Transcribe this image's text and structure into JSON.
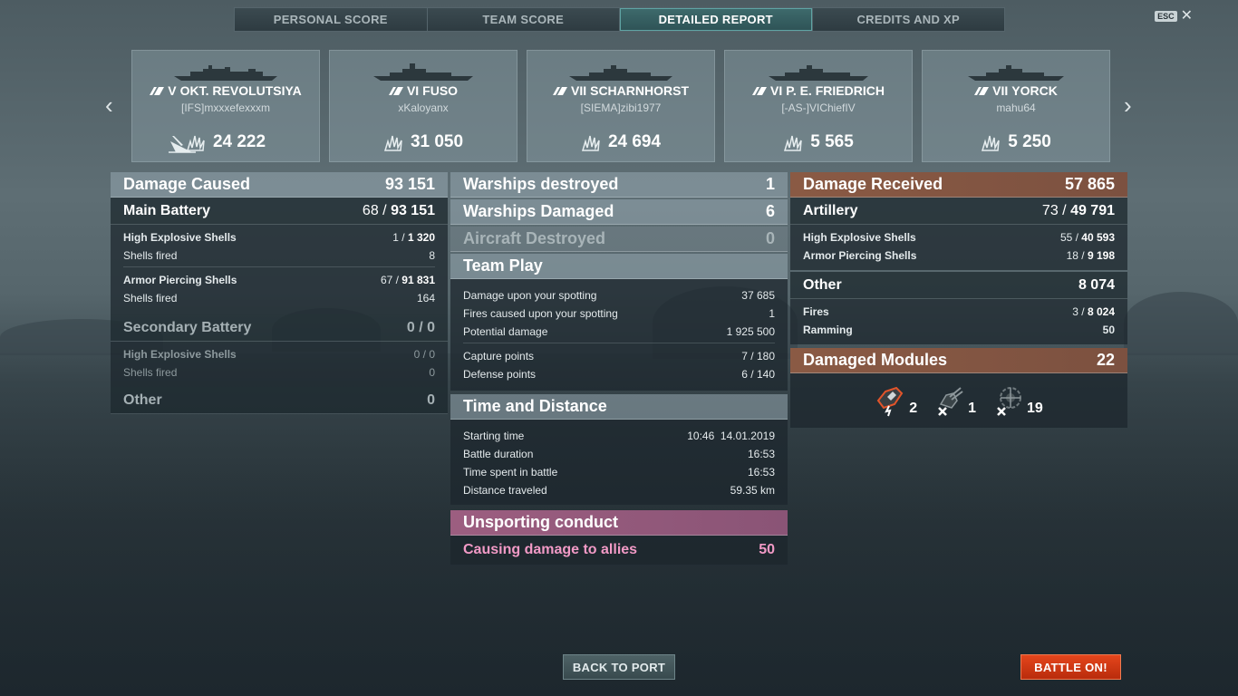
{
  "tabs": [
    {
      "label": "PERSONAL SCORE"
    },
    {
      "label": "TEAM SCORE"
    },
    {
      "label": "DETAILED REPORT",
      "active": true
    },
    {
      "label": "CREDITS AND XP"
    }
  ],
  "esc": {
    "key": "ESC",
    "close": "✕"
  },
  "cards": [
    {
      "tier": "V",
      "ship": "OKT. REVOLUTSIYA",
      "player": "[IFS]mxxxefexxxm",
      "damage": "24 222",
      "sunk": true
    },
    {
      "tier": "VI",
      "ship": "FUSO",
      "player": "xKaloyanx",
      "damage": "31 050"
    },
    {
      "tier": "VII",
      "ship": "SCHARNHORST",
      "player": "[SIEMA]zibi1977",
      "damage": "24 694"
    },
    {
      "tier": "VI",
      "ship": "P. E. FRIEDRICH",
      "player": "[-AS-]VIChiefIV",
      "damage": "5 565"
    },
    {
      "tier": "VII",
      "ship": "YORCK",
      "player": "mahu64",
      "damage": "5 250"
    }
  ],
  "left": {
    "header": {
      "label": "Damage Caused",
      "value": "93 151"
    },
    "main_battery": {
      "label": "Main Battery",
      "hits": "68 /",
      "value": "93 151"
    },
    "he": {
      "label": "High Explosive Shells",
      "hits": "1 /",
      "value": "1 320"
    },
    "he_fired": {
      "label": "Shells fired",
      "value": "8"
    },
    "ap": {
      "label": "Armor Piercing Shells",
      "hits": "67 /",
      "value": "91 831"
    },
    "ap_fired": {
      "label": "Shells fired",
      "value": "164"
    },
    "secondary": {
      "label": "Secondary Battery",
      "value": "0 / 0"
    },
    "sec_he": {
      "label": "High Explosive Shells",
      "value": "0 / 0"
    },
    "sec_fired": {
      "label": "Shells fired",
      "value": "0"
    },
    "other": {
      "label": "Other",
      "value": "0"
    }
  },
  "middle": {
    "destroyed": {
      "label": "Warships destroyed",
      "value": "1"
    },
    "damaged": {
      "label": "Warships Damaged",
      "value": "6"
    },
    "aircraft": {
      "label": "Aircraft Destroyed",
      "value": "0"
    },
    "team_play": {
      "title": "Team Play",
      "rows": [
        {
          "label": "Damage upon your spotting",
          "value": "37 685"
        },
        {
          "label": "Fires caused upon your spotting",
          "value": "1"
        },
        {
          "label": "Potential damage",
          "value": "1 925 500"
        },
        {
          "label": "Capture points",
          "value": "7 / 180"
        },
        {
          "label": "Defense points",
          "value": "6 / 140"
        }
      ]
    },
    "time": {
      "title": "Time and Distance",
      "rows": [
        {
          "label": "Starting time",
          "value": "10:46  14.01.2019"
        },
        {
          "label": "Battle duration",
          "value": "16:53"
        },
        {
          "label": "Time spent in battle",
          "value": "16:53"
        },
        {
          "label": "Distance traveled",
          "value": "59.35 km"
        }
      ]
    },
    "unsporting": {
      "title": "Unsporting conduct",
      "label": "Causing damage to allies",
      "value": "50"
    }
  },
  "right": {
    "header": {
      "label": "Damage Received",
      "value": "57 865"
    },
    "artillery": {
      "label": "Artillery",
      "hits": "73 /",
      "value": "49 791"
    },
    "he": {
      "label": "High Explosive Shells",
      "hits": "55 /",
      "value": "40 593"
    },
    "ap": {
      "label": "Armor Piercing Shells",
      "hits": "18 /",
      "value": "9 198"
    },
    "other": {
      "label": "Other",
      "value": "8 074"
    },
    "fires": {
      "label": "Fires",
      "hits": "3 /",
      "value": "8 024"
    },
    "ramming": {
      "label": "Ramming",
      "value": "50"
    },
    "modules": {
      "label": "Damaged Modules",
      "value": "22",
      "items": [
        {
          "icon": "engine-damaged-icon",
          "count": "2"
        },
        {
          "icon": "turret-destroyed-icon",
          "count": "1"
        },
        {
          "icon": "aa-destroyed-icon",
          "count": "19"
        }
      ]
    }
  },
  "buttons": {
    "back": "BACK TO PORT",
    "battle": "BATTLE ON!"
  },
  "colors": {
    "active_tab": "#2e5356",
    "received": "#8a5a44",
    "unsporting": "#9c5e80",
    "battle_button": "#d03a14",
    "pink_text": "#f29ac6"
  }
}
